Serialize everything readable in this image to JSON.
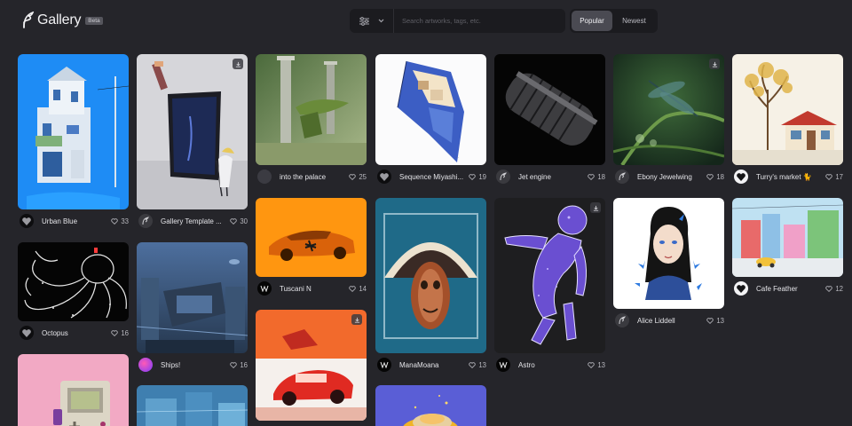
{
  "app": {
    "name": "Gallery",
    "badge": "Beta"
  },
  "search": {
    "placeholder": "Search artworks, tags, etc."
  },
  "sort": {
    "popular": "Popular",
    "newest": "Newest"
  },
  "colors": {
    "background": "#25252a",
    "panel": "#1b1b1f",
    "active_sort": "#4a4a52"
  },
  "cards": [
    {
      "title": "Urban Blue",
      "likes": "33",
      "download": false
    },
    {
      "title": "Octopus",
      "likes": "16",
      "download": false
    },
    {
      "title": "",
      "likes": "",
      "download": false
    },
    {
      "title": "Gallery Template ...",
      "likes": "30",
      "download": true
    },
    {
      "title": "Ships!",
      "likes": "16",
      "download": false
    },
    {
      "title": "",
      "likes": "",
      "download": false
    },
    {
      "title": "into the palace",
      "likes": "25",
      "download": false
    },
    {
      "title": "Tuscani N",
      "likes": "14",
      "download": false
    },
    {
      "title": "",
      "likes": "",
      "download": true
    },
    {
      "title": "Sequence Miyashi...",
      "likes": "19",
      "download": false
    },
    {
      "title": "ManaMoana",
      "likes": "13",
      "download": false
    },
    {
      "title": "",
      "likes": "",
      "download": false
    },
    {
      "title": "Jet engine",
      "likes": "18",
      "download": false
    },
    {
      "title": "Astro",
      "likes": "13",
      "download": true
    },
    {
      "title": "Ebony Jewelwing",
      "likes": "18",
      "download": true
    },
    {
      "title": "Alice Liddell",
      "likes": "13",
      "download": false
    },
    {
      "title": "Turry's market 🐈",
      "likes": "17",
      "download": false
    },
    {
      "title": "Cafe Feather",
      "likes": "12",
      "download": false
    }
  ]
}
